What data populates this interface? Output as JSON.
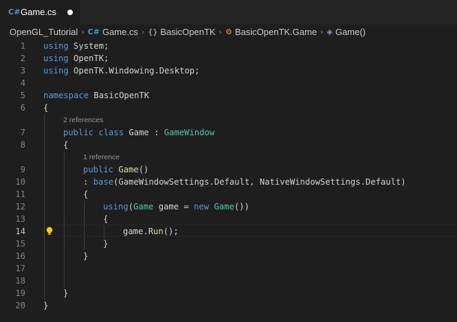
{
  "tab": {
    "icon": "csharp-file-icon",
    "icon_glyph": "C#",
    "label": "Game.cs"
  },
  "breadcrumb": {
    "project": "OpenGL_Tutorial",
    "file": "Game.cs",
    "namespace_glyph": "{}",
    "namespace": "BasicOpenTK",
    "class": "BasicOpenTK.Game",
    "method": "Game()"
  },
  "codelens": {
    "class_refs": "2 references",
    "ctor_refs": "1 reference"
  },
  "line_numbers": [
    "1",
    "2",
    "3",
    "4",
    "5",
    "6",
    "7",
    "8",
    "9",
    "10",
    "11",
    "12",
    "13",
    "14",
    "15",
    "16",
    "17",
    "18",
    "19",
    "20"
  ],
  "active_line": "14",
  "code": {
    "l1": {
      "kw": "using",
      "rest": " System;"
    },
    "l2": {
      "kw": "using",
      "rest": " OpenTK;"
    },
    "l3": {
      "kw": "using",
      "rest": " OpenTK.Windowing.Desktop;"
    },
    "l5": {
      "kw": "namespace",
      "rest": " BasicOpenTK"
    },
    "l6": "{",
    "l7": {
      "kw1": "public",
      "kw2": " class",
      "name": " Game : ",
      "base": "GameWindow"
    },
    "l8": "{",
    "l9": {
      "kw": "public",
      "name": " Game",
      "rest": "()"
    },
    "l10": {
      "pre": ": ",
      "kw": "base",
      "rest": "(GameWindowSettings.Default, NativeWindowSettings.Default)"
    },
    "l11": "{",
    "l12": {
      "kw": "using",
      "p1": "(",
      "type": "Game",
      "p2": " game = ",
      "kw2": "new",
      "sp": " ",
      "type2": "Game",
      "p3": "())"
    },
    "l13": "{",
    "l14": {
      "obj": "game.",
      "method": "Run",
      "rest": "();"
    },
    "l15": "}",
    "l16": "}",
    "l19": "}",
    "l20": "}"
  },
  "colors": {
    "background": "#1e1e1e",
    "keyword": "#569cd6",
    "type": "#4ec9b0",
    "function": "#dcdcaa",
    "text": "#d4d4d4",
    "lightbulb": "#ffcc00"
  }
}
